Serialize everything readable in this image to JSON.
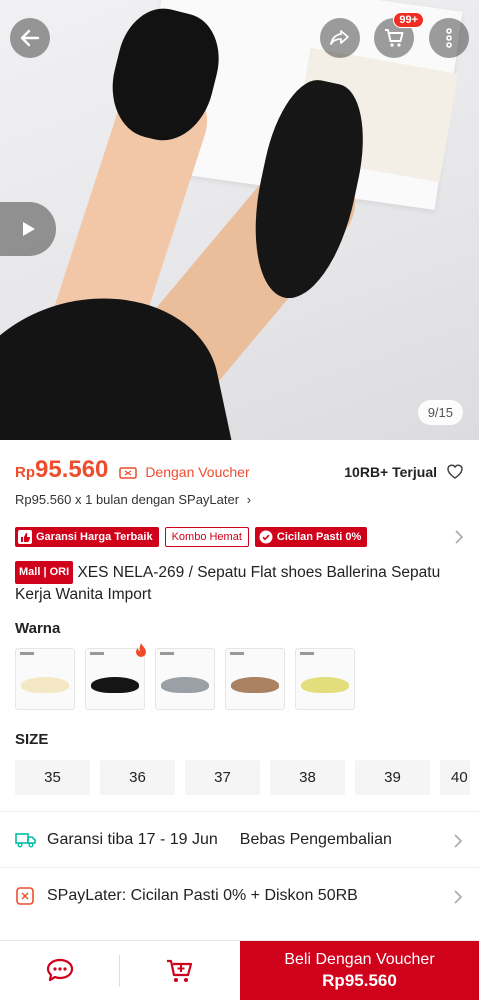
{
  "header": {
    "cart_badge": "99+",
    "image_counter": "9/15"
  },
  "price": {
    "currency": "Rp",
    "amount": "95.560",
    "voucher_label": "Dengan Voucher",
    "sold": "10RB+ Terjual",
    "paylater": "Rp95.560 x 1 bulan dengan SPayLater"
  },
  "promos": {
    "guarantee": "Garansi Harga Terbaik",
    "combo": "Kombo Hemat",
    "installment": "Cicilan Pasti 0%"
  },
  "product": {
    "mall_tag": "Mall | ORI",
    "title": "XES NELA-269 / Sepatu Flat shoes Ballerina Sepatu Kerja Wanita Import"
  },
  "variants": {
    "label": "Warna",
    "colors": [
      "#f3e7c4",
      "#151515",
      "#9aa0a6",
      "#a98262",
      "#e3de7c"
    ]
  },
  "sizes": {
    "label": "SIZE",
    "options": [
      "35",
      "36",
      "37",
      "38",
      "39",
      "40"
    ]
  },
  "shipping": {
    "guarantee": "Garansi tiba 17 - 19 Jun",
    "returns": "Bebas Pengembalian"
  },
  "spaylater": {
    "text": "SPayLater: Cicilan Pasti 0% + Diskon 50RB"
  },
  "bottom": {
    "buy_label": "Beli Dengan Voucher",
    "buy_price": "Rp95.560"
  },
  "colors": {
    "accent": "#ee4d2d",
    "mall_red": "#d0011b"
  }
}
